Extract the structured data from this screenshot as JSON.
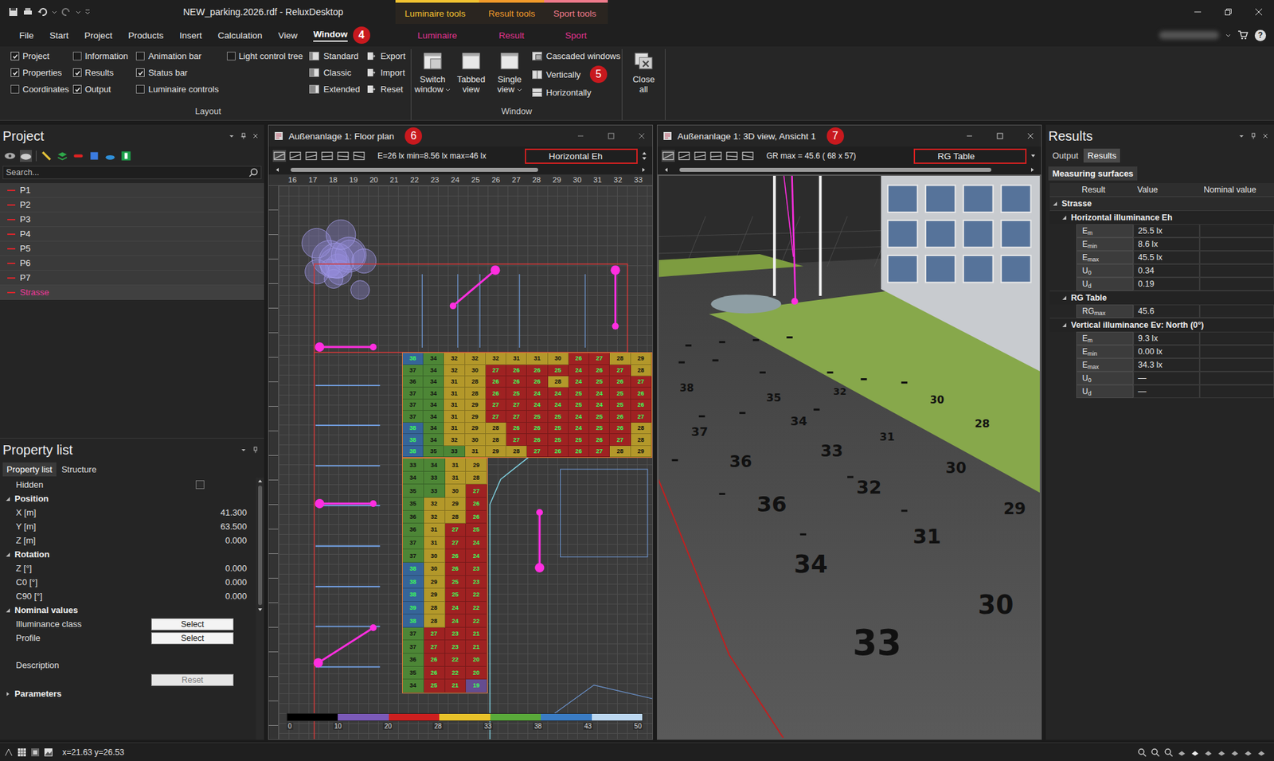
{
  "titlebar": {
    "title": "NEW_parking.2026.rdf - ReluxDesktop",
    "context_groups": [
      {
        "label": "Luminaire tools",
        "color": "#f2c230"
      },
      {
        "label": "Result tools",
        "color": "#f39a2a"
      },
      {
        "label": "Sport tools",
        "color": "#f07a8a"
      }
    ]
  },
  "menubar": {
    "items": [
      {
        "label": "File",
        "selected": false,
        "kind": "standard",
        "badge": ""
      },
      {
        "label": "Start",
        "selected": false,
        "kind": "standard",
        "badge": ""
      },
      {
        "label": "Project",
        "selected": false,
        "kind": "standard",
        "badge": ""
      },
      {
        "label": "Products",
        "selected": false,
        "kind": "standard",
        "badge": ""
      },
      {
        "label": "Insert",
        "selected": false,
        "kind": "standard",
        "badge": ""
      },
      {
        "label": "Calculation",
        "selected": false,
        "kind": "standard",
        "badge": ""
      },
      {
        "label": "View",
        "selected": false,
        "kind": "standard",
        "badge": ""
      },
      {
        "label": "Window",
        "selected": true,
        "kind": "standard",
        "badge": "4"
      },
      {
        "label": "Luminaire",
        "selected": false,
        "kind": "contextual",
        "badge": ""
      },
      {
        "label": "Result",
        "selected": false,
        "kind": "contextual",
        "badge": ""
      },
      {
        "label": "Sport",
        "selected": false,
        "kind": "contextual",
        "badge": ""
      }
    ],
    "help": "?"
  },
  "ribbon": {
    "layout": {
      "label": "Layout",
      "checkbox_columns": [
        [
          {
            "label": "Project",
            "checked": true
          },
          {
            "label": "Properties",
            "checked": true
          },
          {
            "label": "Coordinates",
            "checked": false
          }
        ],
        [
          {
            "label": "Information",
            "checked": false
          },
          {
            "label": "Results",
            "checked": true
          },
          {
            "label": "Output",
            "checked": true
          }
        ],
        [
          {
            "label": "Animation bar",
            "checked": false
          },
          {
            "label": "Status bar",
            "checked": true
          },
          {
            "label": "Luminaire controls",
            "checked": false
          }
        ],
        [
          {
            "label": "Light control tree",
            "checked": false
          }
        ]
      ],
      "presets": [
        "Standard",
        "Classic",
        "Extended"
      ],
      "files": [
        "Export",
        "Import",
        "Reset"
      ]
    },
    "window": {
      "label": "Window",
      "large": [
        {
          "lines": [
            "Switch",
            "window"
          ],
          "dropdown": true
        },
        {
          "lines": [
            "Tabbed",
            "view"
          ],
          "dropdown": false
        },
        {
          "lines": [
            "Single",
            "view"
          ],
          "dropdown": true
        }
      ],
      "arrange": [
        {
          "label": "Cascaded windows",
          "badge": ""
        },
        {
          "label": "Vertically",
          "badge": "5"
        },
        {
          "label": "Horizontally",
          "badge": ""
        }
      ]
    },
    "close": {
      "lines": [
        "Close",
        "all"
      ]
    }
  },
  "project": {
    "title": "Project",
    "search_placeholder": "Search...",
    "items": [
      {
        "label": "P1",
        "selected": false
      },
      {
        "label": "P2",
        "selected": false
      },
      {
        "label": "P3",
        "selected": false
      },
      {
        "label": "P4",
        "selected": false
      },
      {
        "label": "P5",
        "selected": false
      },
      {
        "label": "P6",
        "selected": false
      },
      {
        "label": "P7",
        "selected": false
      },
      {
        "label": "Strasse",
        "selected": true
      }
    ]
  },
  "properties": {
    "title": "Property list",
    "tabs": [
      {
        "label": "Property list",
        "selected": true
      },
      {
        "label": "Structure",
        "selected": false
      }
    ],
    "rows": [
      {
        "kind": "check",
        "label": "Hidden",
        "value": "",
        "checked": false,
        "expanded": false,
        "disabled": false
      },
      {
        "kind": "group",
        "label": "Position",
        "value": "",
        "checked": false,
        "expanded": true,
        "disabled": false
      },
      {
        "kind": "value",
        "label": "X [m]",
        "value": "41.300",
        "checked": false,
        "expanded": false,
        "disabled": false
      },
      {
        "kind": "value",
        "label": "Y [m]",
        "value": "63.500",
        "checked": false,
        "expanded": false,
        "disabled": false
      },
      {
        "kind": "value",
        "label": "Z [m]",
        "value": "0.000",
        "checked": false,
        "expanded": false,
        "disabled": false
      },
      {
        "kind": "group",
        "label": "Rotation",
        "value": "",
        "checked": false,
        "expanded": true,
        "disabled": false
      },
      {
        "kind": "value",
        "label": "Z [°]",
        "value": "0.000",
        "checked": false,
        "expanded": false,
        "disabled": false
      },
      {
        "kind": "value",
        "label": "C0 [°]",
        "value": "0.000",
        "checked": false,
        "expanded": false,
        "disabled": false
      },
      {
        "kind": "value",
        "label": "C90 [°]",
        "value": "0.000",
        "checked": false,
        "expanded": false,
        "disabled": false
      },
      {
        "kind": "group",
        "label": "Nominal values",
        "value": "",
        "checked": false,
        "expanded": true,
        "disabled": false
      },
      {
        "kind": "button",
        "label": "Illuminance class",
        "value": "Select",
        "checked": false,
        "expanded": false,
        "disabled": false
      },
      {
        "kind": "button",
        "label": "Profile",
        "value": "Select",
        "checked": false,
        "expanded": false,
        "disabled": false
      },
      {
        "kind": "text",
        "label": "Description",
        "value": "",
        "checked": false,
        "expanded": false,
        "disabled": false
      },
      {
        "kind": "button",
        "label": "",
        "value": "Reset",
        "checked": false,
        "expanded": false,
        "disabled": true
      },
      {
        "kind": "group",
        "label": "Parameters",
        "value": "",
        "checked": false,
        "expanded": false,
        "disabled": false
      }
    ]
  },
  "floor_plan": {
    "title": "Außenanlage 1: Floor plan",
    "badge": "6",
    "stats": "E=26 lx min=8.56 lx max=46 lx",
    "view": "Horizontal Eh",
    "ruler": [
      "16",
      "17",
      "18",
      "19",
      "20",
      "21",
      "22",
      "23",
      "24",
      "25",
      "26",
      "27",
      "28",
      "29",
      "30",
      "31",
      "32",
      "33"
    ],
    "grid_top": [
      [
        "38",
        "34",
        "32",
        "32",
        "32",
        "31",
        "31",
        "30",
        "26",
        "27",
        "28",
        "29"
      ],
      [
        "37",
        "34",
        "32",
        "30",
        "27",
        "26",
        "26",
        "25",
        "24",
        "26",
        "27",
        "28"
      ],
      [
        "36",
        "34",
        "31",
        "28",
        "26",
        "26",
        "26",
        "28",
        "24",
        "25",
        "26",
        "27"
      ],
      [
        "37",
        "34",
        "31",
        "28",
        "26",
        "25",
        "24",
        "24",
        "25",
        "24",
        "25",
        "26"
      ],
      [
        "37",
        "34",
        "31",
        "29",
        "27",
        "27",
        "24",
        "24",
        "25",
        "24",
        "25",
        "26"
      ],
      [
        "37",
        "34",
        "31",
        "29",
        "27",
        "27",
        "25",
        "25",
        "24",
        "25",
        "26",
        "27"
      ],
      [
        "38",
        "34",
        "31",
        "29",
        "28",
        "26",
        "26",
        "25",
        "24",
        "25",
        "26",
        "28"
      ],
      [
        "38",
        "34",
        "32",
        "30",
        "28",
        "27",
        "26",
        "25",
        "25",
        "26",
        "27",
        "28"
      ],
      [
        "38",
        "35",
        "33",
        "31",
        "29",
        "28",
        "27",
        "26",
        "26",
        "27",
        "28",
        "29"
      ]
    ],
    "grid_bottom": [
      [
        "33",
        "34",
        "31",
        "29"
      ],
      [
        "34",
        "33",
        "31",
        "28"
      ],
      [
        "35",
        "33",
        "30",
        "27"
      ],
      [
        "35",
        "32",
        "29",
        "26"
      ],
      [
        "36",
        "32",
        "28",
        "26"
      ],
      [
        "36",
        "31",
        "27",
        "25"
      ],
      [
        "37",
        "31",
        "27",
        "24"
      ],
      [
        "37",
        "30",
        "26",
        "24"
      ],
      [
        "38",
        "30",
        "26",
        "23"
      ],
      [
        "38",
        "29",
        "25",
        "23"
      ],
      [
        "38",
        "29",
        "25",
        "22"
      ],
      [
        "39",
        "28",
        "24",
        "22"
      ],
      [
        "38",
        "28",
        "24",
        "22"
      ],
      [
        "37",
        "27",
        "23",
        "21"
      ],
      [
        "37",
        "27",
        "23",
        "21"
      ],
      [
        "36",
        "26",
        "22",
        "20"
      ],
      [
        "35",
        "26",
        "22",
        "20"
      ],
      [
        "34",
        "25",
        "21",
        "19"
      ]
    ],
    "legend": {
      "segments": [
        {
          "color": "#000000"
        },
        {
          "color": "#7b5ab8"
        },
        {
          "color": "#cc1f1f"
        },
        {
          "color": "#e8c22a"
        },
        {
          "color": "#5aaa3a"
        },
        {
          "color": "#3a7cc4"
        },
        {
          "color": "#bcd8f0"
        }
      ],
      "ticks": [
        "0",
        "10",
        "20",
        "28",
        "33",
        "38",
        "43",
        "50"
      ]
    }
  },
  "view3d": {
    "title": "Außenanlage 1: 3D view, Ansicht 1",
    "badge": "7",
    "stats": "GR max = 45.6 ( 68 x 57)",
    "view": "RG Table",
    "labels": [
      "33",
      "30",
      "34",
      "31",
      "36",
      "32",
      "29",
      "33",
      "30",
      "36",
      "37",
      "34",
      "35",
      "38",
      "28",
      "30",
      "31",
      "32"
    ]
  },
  "results": {
    "title": "Results",
    "tabs": [
      {
        "label": "Output",
        "selected": false
      },
      {
        "label": "Results",
        "selected": true
      }
    ],
    "section": "Measuring surfaces",
    "columns": [
      "Result",
      "Value",
      "Nominal value"
    ],
    "rows": [
      {
        "kind": "group",
        "label": "Strasse",
        "sub": "",
        "value": "",
        "nominal": ""
      },
      {
        "kind": "subgroup",
        "label": "Horizontal illuminance Eh",
        "sub": "",
        "value": "",
        "nominal": ""
      },
      {
        "kind": "value",
        "label": "E",
        "sub": "m",
        "value": "25.5 lx",
        "nominal": ""
      },
      {
        "kind": "value",
        "label": "E",
        "sub": "min",
        "value": "8.6 lx",
        "nominal": ""
      },
      {
        "kind": "value",
        "label": "E",
        "sub": "max",
        "value": "45.5 lx",
        "nominal": ""
      },
      {
        "kind": "value",
        "label": "U",
        "sub": "0",
        "value": "0.34",
        "nominal": ""
      },
      {
        "kind": "value",
        "label": "U",
        "sub": "d",
        "value": "0.19",
        "nominal": ""
      },
      {
        "kind": "subgroup",
        "label": "RG Table",
        "sub": "",
        "value": "",
        "nominal": ""
      },
      {
        "kind": "value",
        "label": "RG",
        "sub": "max",
        "value": "45.6",
        "nominal": ""
      },
      {
        "kind": "subgroup",
        "label": "Vertical illuminance Ev: North (0°)",
        "sub": "",
        "value": "",
        "nominal": ""
      },
      {
        "kind": "value",
        "label": "E",
        "sub": "m",
        "value": "9.3 lx",
        "nominal": ""
      },
      {
        "kind": "value",
        "label": "E",
        "sub": "min",
        "value": "0.00 lx",
        "nominal": ""
      },
      {
        "kind": "value",
        "label": "E",
        "sub": "max",
        "value": "34.3 lx",
        "nominal": ""
      },
      {
        "kind": "value",
        "label": "U",
        "sub": "0",
        "value": "—",
        "nominal": ""
      },
      {
        "kind": "value",
        "label": "U",
        "sub": "d",
        "value": "—",
        "nominal": ""
      }
    ]
  },
  "statusbar": {
    "coords": "x=21.63 y=26.53"
  }
}
